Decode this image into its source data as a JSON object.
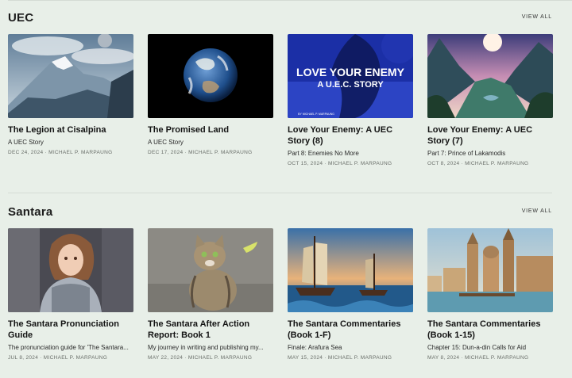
{
  "sections": [
    {
      "title": "UEC",
      "view_all": "VIEW ALL",
      "posts": [
        {
          "title": "The Legion at Cisalpina",
          "subtitle": "A UEC Story",
          "meta": "DEC 24, 2024 · MICHAEL P. MARPAUNG",
          "image": "mountain-landscape"
        },
        {
          "title": "The Promised Land",
          "subtitle": "A UEC Story",
          "meta": "DEC 17, 2024 · MICHAEL P. MARPAUNG",
          "image": "earth-from-space"
        },
        {
          "title": "Love Your Enemy: A UEC Story (8)",
          "subtitle": "Part 8: Enemies No More",
          "meta": "OCT 15, 2024 · MICHAEL P. MARPAUNG",
          "image": "love-your-enemy-cover",
          "cover": {
            "line1": "LOVE YOUR ENEMY",
            "line2": "A U.E.C. STORY",
            "byline": "BY MICHAEL P. MARPAUNG"
          }
        },
        {
          "title": "Love Your Enemy: A UEC Story (7)",
          "subtitle": "Part 7: Prince of Lakamodis",
          "meta": "OCT 8, 2024 · MICHAEL P. MARPAUNG",
          "image": "fantasy-valley"
        }
      ]
    },
    {
      "title": "Santara",
      "view_all": "VIEW ALL",
      "posts": [
        {
          "title": "The Santara Pronunciation Guide",
          "subtitle": "The pronunciation guide for 'The Santara...",
          "meta": "JUL 8, 2024 · MICHAEL P. MARPAUNG",
          "image": "armored-woman"
        },
        {
          "title": "The Santara After Action Report: Book 1",
          "subtitle": "My journey in writing and publishing my...",
          "meta": "MAY 22, 2024 · MICHAEL P. MARPAUNG",
          "image": "tabby-cat"
        },
        {
          "title": "The Santara Commentaries (Book 1-F)",
          "subtitle": "Finale: Arafura Sea",
          "meta": "MAY 15, 2024 · MICHAEL P. MARPAUNG",
          "image": "sailing-ships"
        },
        {
          "title": "The Santara Commentaries (Book 1-15)",
          "subtitle": "Chapter 15: Dun-a-din Calls for Aid",
          "meta": "MAY 8, 2024 · MICHAEL P. MARPAUNG",
          "image": "harbor-city"
        }
      ]
    }
  ]
}
